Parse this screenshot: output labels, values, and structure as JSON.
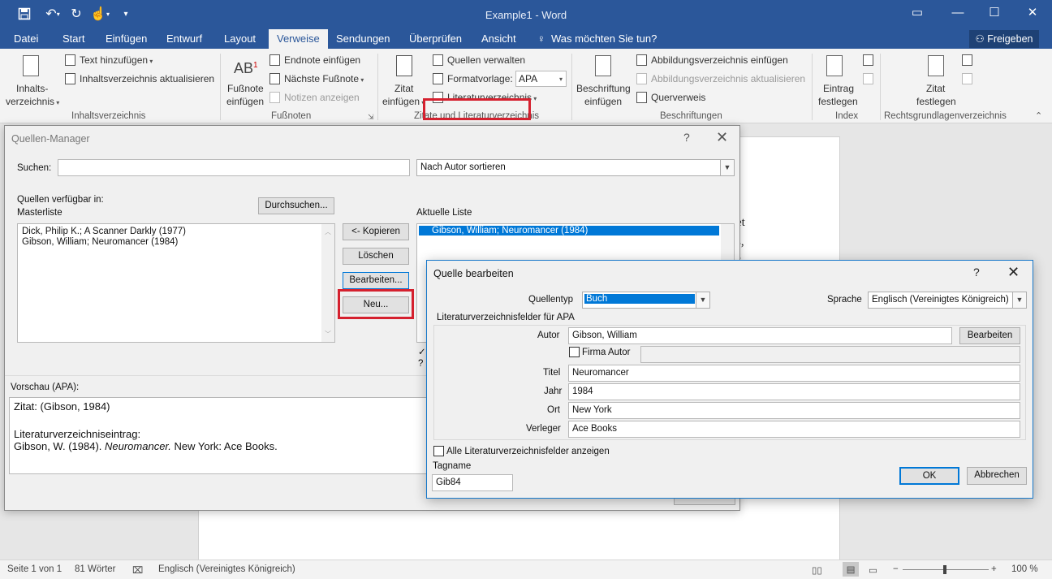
{
  "window": {
    "title": "Example1 - Word",
    "share": "Freigeben"
  },
  "tabs": [
    "Datei",
    "Start",
    "Einfügen",
    "Entwurf",
    "Layout",
    "Verweise",
    "Sendungen",
    "Überprüfen",
    "Ansicht"
  ],
  "tell_me": "Was möchten Sie tun?",
  "ribbon": {
    "toc_line1": "Inhalts-",
    "toc_line2": "verzeichnis",
    "add_text": "Text hinzufügen",
    "update_toc": "Inhaltsverzeichnis aktualisieren",
    "group_toc": "Inhaltsverzeichnis",
    "footnote_line1": "Fußnote",
    "footnote_line2": "einfügen",
    "endnote": "Endnote einfügen",
    "next_footnote": "Nächste Fußnote",
    "show_notes": "Notizen anzeigen",
    "group_footnotes": "Fußnoten",
    "cite_line1": "Zitat",
    "cite_line2": "einfügen",
    "manage_sources": "Quellen verwalten",
    "style_label": "Formatvorlage:",
    "style_value": "APA",
    "bibliography": "Literaturverzeichnis",
    "group_citations": "Zitate und Literaturverzeichnis",
    "caption_line1": "Beschriftung",
    "caption_line2": "einfügen",
    "insert_tof": "Abbildungsverzeichnis einfügen",
    "update_tof": "Abbildungsverzeichnis aktualisieren",
    "cross_ref": "Querverweis",
    "group_captions": "Beschriftungen",
    "mark_entry_line1": "Eintrag",
    "mark_entry_line2": "festlegen",
    "group_index": "Index",
    "mark_cite_line1": "Zitat",
    "mark_cite_line2": "festlegen",
    "group_toa": "Rechtsgrundlagenverzeichnis"
  },
  "document": {
    "fragments": [
      "et",
      "s,",
      "s"
    ]
  },
  "status": {
    "page": "Seite 1 von 1",
    "words": "81 Wörter",
    "lang": "Englisch (Vereinigtes Königreich)",
    "zoom": "100 %"
  },
  "source_manager": {
    "title": "Quellen-Manager",
    "search_label": "Suchen:",
    "search_value": "",
    "sort_value": "Nach Autor sortieren",
    "available_label": "Quellen verfügbar in:",
    "master_label": "Masterliste",
    "browse_button": "Durchsuchen...",
    "master_items": [
      "Dick, Philip K.; A Scanner Darkly (1977)",
      "Gibson, William; Neuromancer (1984)"
    ],
    "copy_button": "<- Kopieren",
    "delete_button": "Löschen",
    "edit_button": "Bearbeiten...",
    "new_button": "Neu...",
    "current_label": "Aktuelle Liste",
    "current_items": [
      "Gibson, William; Neuromancer (1984)"
    ],
    "legend_check": "✓",
    "legend_q": "?",
    "preview_label": "Vorschau (APA):",
    "preview_cite": "Zitat:  (Gibson, 1984)",
    "preview_bib_label": "Literaturverzeichniseintrag:",
    "preview_bib_prefix": "Gibson, W. (1984). ",
    "preview_bib_title": "Neuromancer.",
    "preview_bib_suffix": " New York: Ace Books."
  },
  "edit_source": {
    "title": "Quelle bearbeiten",
    "type_label": "Quellentyp",
    "type_value": "Buch",
    "lang_label": "Sprache",
    "lang_value": "Englisch (Vereinigtes Königreich)",
    "fields_header": "Literaturverzeichnisfelder für APA",
    "author_label": "Autor",
    "author_value": "Gibson, William",
    "author_edit_button": "Bearbeiten",
    "corporate_label": "Firma Autor",
    "title_label": "Titel",
    "title_value": "Neuromancer",
    "year_label": "Jahr",
    "year_value": "1984",
    "city_label": "Ort",
    "city_value": "New York",
    "publisher_label": "Verleger",
    "publisher_value": "Ace Books",
    "show_all_label": "Alle Literaturverzeichnisfelder anzeigen",
    "tag_label": "Tagname",
    "tag_value": "Gib84",
    "ok_button": "OK",
    "cancel_button": "Abbrechen"
  },
  "colors": {
    "accent": "#2b579a",
    "highlight": "#d5212f",
    "selection": "#0078d7"
  }
}
